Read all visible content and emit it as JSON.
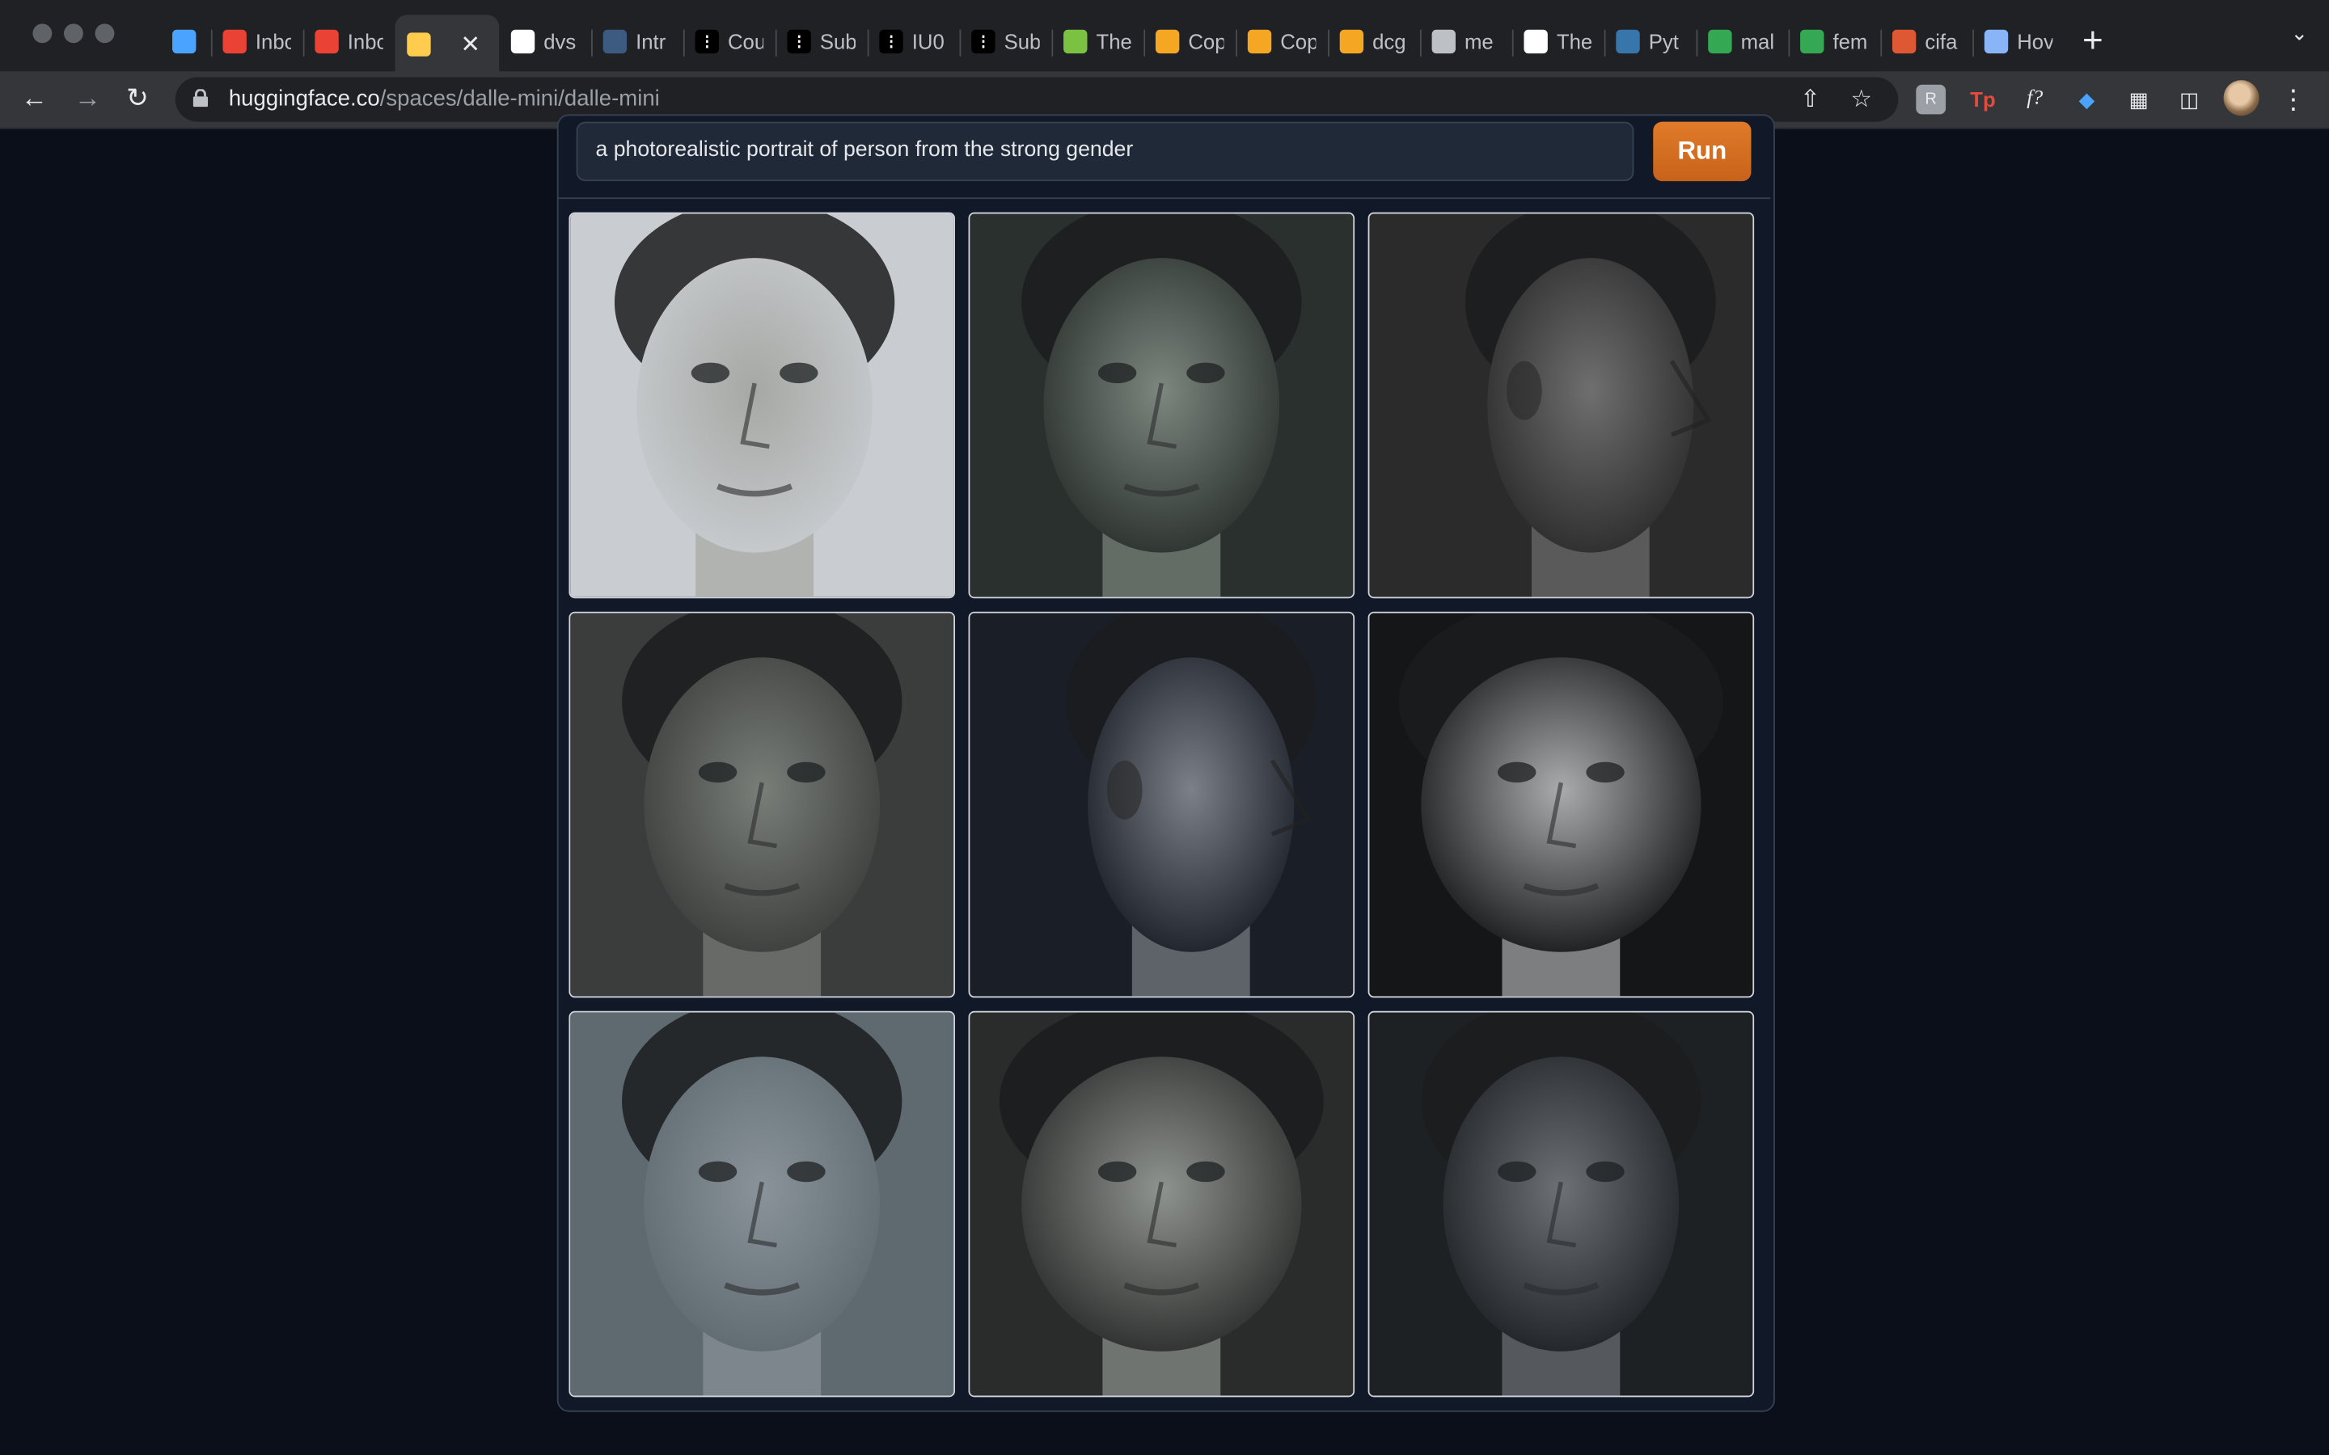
{
  "browser": {
    "tabs": [
      {
        "title": "",
        "icon": "gem-icon",
        "color": "#4aa3ff"
      },
      {
        "title": "Inbox",
        "icon": "gmail-icon",
        "color": "#ea4335"
      },
      {
        "title": "Inbox",
        "icon": "gmail-icon",
        "color": "#ea4335"
      },
      {
        "title": "",
        "icon": "huggingface-icon",
        "color": "#ffcc4d",
        "active": true
      },
      {
        "title": "dvs",
        "icon": "github-icon",
        "color": "#ffffff"
      },
      {
        "title": "Intr",
        "icon": "tds-icon",
        "color": "#3d5a80"
      },
      {
        "title": "Cou",
        "icon": "dots-icon",
        "color": "#000000"
      },
      {
        "title": "Sub",
        "icon": "dots-icon",
        "color": "#000000"
      },
      {
        "title": "IU0",
        "icon": "dots-icon",
        "color": "#000000"
      },
      {
        "title": "Sub",
        "icon": "dots-icon",
        "color": "#000000"
      },
      {
        "title": "The",
        "icon": "smiley-icon",
        "color": "#7cc242"
      },
      {
        "title": "Cop",
        "icon": "infinity-icon",
        "color": "#f5a623"
      },
      {
        "title": "Cop",
        "icon": "infinity-icon",
        "color": "#f5a623"
      },
      {
        "title": "dcg",
        "icon": "infinity-icon",
        "color": "#f5a623"
      },
      {
        "title": "me",
        "icon": "infinity-icon",
        "color": "#bdc1c6"
      },
      {
        "title": "The",
        "icon": "newspaper-icon",
        "color": "#ffffff"
      },
      {
        "title": "Pyt",
        "icon": "python-icon",
        "color": "#3776ab"
      },
      {
        "title": "mal",
        "icon": "drive-icon",
        "color": "#34a853"
      },
      {
        "title": "fem",
        "icon": "drive-icon",
        "color": "#34a853"
      },
      {
        "title": "cifa",
        "icon": "duckduckgo-icon",
        "color": "#de5833"
      },
      {
        "title": "Hov",
        "icon": "book-icon",
        "color": "#8ab4f8"
      }
    ],
    "url_host": "huggingface.co",
    "url_path": "/spaces/dalle-mini/dalle-mini"
  },
  "app": {
    "prompt_text": "a photorealistic portrait of person from the strong gender",
    "run_label": "Run",
    "accent": "#d9702a",
    "results": [
      {
        "pose": "front-left",
        "bg": "#c9ccd0",
        "skin": "#a6a8a4"
      },
      {
        "pose": "front",
        "bg": "#2a302d",
        "skin": "#7c877f"
      },
      {
        "pose": "profile-right",
        "bg": "#2b2b2b",
        "skin": "#6f6f6f"
      },
      {
        "pose": "front",
        "bg": "#3a3d3b",
        "skin": "#7a7e79"
      },
      {
        "pose": "profile-right",
        "bg": "#1a1e26",
        "skin": "#7c8088"
      },
      {
        "pose": "front-wide",
        "bg": "#151618",
        "skin": "#a9abad"
      },
      {
        "pose": "front",
        "bg": "#5f6a70",
        "skin": "#8a939a"
      },
      {
        "pose": "front-wide",
        "bg": "#2a2c2b",
        "skin": "#8f938f"
      },
      {
        "pose": "front",
        "bg": "#1e2124",
        "skin": "#6c7176"
      }
    ]
  }
}
